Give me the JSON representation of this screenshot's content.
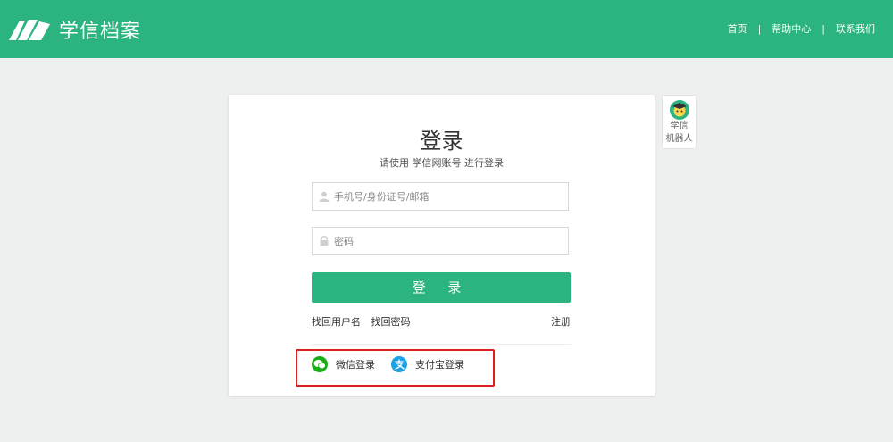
{
  "header": {
    "brand": "学信档案",
    "nav": [
      {
        "label": "首页"
      },
      {
        "label": "帮助中心"
      },
      {
        "label": "联系我们"
      }
    ],
    "separator": "|"
  },
  "login": {
    "title": "登录",
    "subtitle": "请使用 学信网账号 进行登录",
    "username": {
      "placeholder": "手机号/身份证号/邮箱",
      "value": ""
    },
    "password": {
      "placeholder": "密码",
      "value": ""
    },
    "submit_label": "登 录",
    "find_username": "找回用户名",
    "find_password": "找回密码",
    "register": "注册",
    "third_party": [
      {
        "label": "微信登录",
        "icon": "wechat-icon",
        "color": "#1aad19"
      },
      {
        "label": "支付宝登录",
        "icon": "alipay-icon",
        "color": "#1ba1e6"
      }
    ]
  },
  "robot": {
    "line1": "学信",
    "line2": "机器人"
  },
  "colors": {
    "brand_green": "#2bb47f",
    "highlight_red": "#e02020",
    "background": "#eef0f0"
  }
}
